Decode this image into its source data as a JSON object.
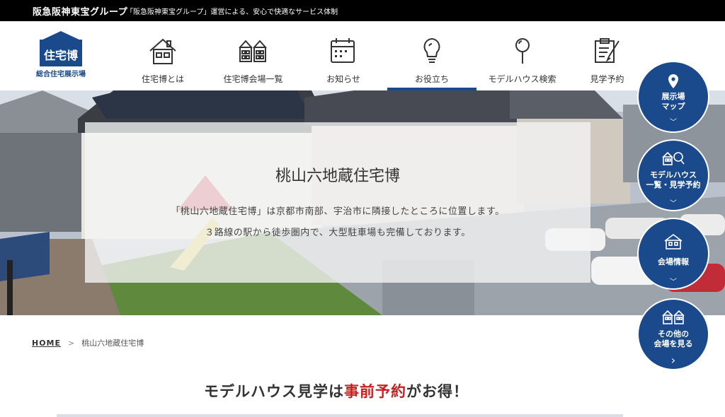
{
  "topbar": {
    "brand": "阪急阪神東宝グループ",
    "tagline": "「阪急阪神東宝グループ」運営による、安心で快適なサービス体制"
  },
  "logo": {
    "box_text": "住宅博",
    "subtitle": "総合住宅展示場"
  },
  "nav": {
    "items": [
      {
        "label": "住宅博とは",
        "icon": "house-icon"
      },
      {
        "label": "住宅博会場一覧",
        "icon": "houses-row-icon"
      },
      {
        "label": "お知らせ",
        "icon": "calendar-icon"
      },
      {
        "label": "お役立ち",
        "icon": "lightbulb-icon",
        "active": true
      },
      {
        "label": "モデルハウス検索",
        "icon": "magnifier-icon"
      },
      {
        "label": "見学予約",
        "icon": "clipboard-pen-icon"
      }
    ]
  },
  "hero": {
    "title": "桃山六地蔵住宅博",
    "desc_line1": "「桃山六地蔵住宅博」は京都市南部、宇治市に隣接したところに位置します。",
    "desc_line2": "３路線の駅から徒歩圏内で、大型駐車場も完備しております。"
  },
  "breadcrumb": {
    "home": "HOME",
    "separator": ">",
    "current": "桃山六地蔵住宅博"
  },
  "headline": {
    "part1": "モデルハウス見学は",
    "part2": "事前予約",
    "part3": "がお得！"
  },
  "floating": [
    {
      "label": "展示場\nマップ",
      "icon": "map-pin-icon",
      "chevron": "﹀"
    },
    {
      "label": "モデルハウス\n一覧・見学予約",
      "icon": "house-search-icon",
      "chevron": "﹀"
    },
    {
      "label": "会場情報",
      "icon": "venue-icon",
      "chevron": "﹀"
    },
    {
      "label": "その他の\n会場を見る",
      "icon": "other-venues-icon",
      "chevron": "›"
    }
  ],
  "colors": {
    "brand_blue": "#1a4a8c",
    "accent_red": "#c81e1e",
    "topbar_bg": "#000000"
  }
}
